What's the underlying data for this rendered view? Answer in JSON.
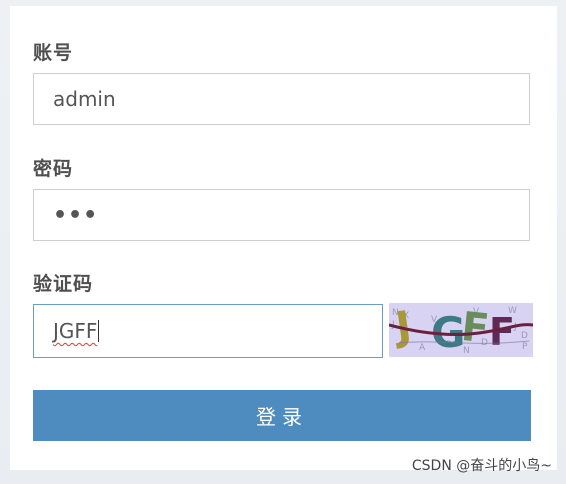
{
  "form": {
    "username_label": "账号",
    "username_value": "admin",
    "password_label": "密码",
    "password_value": "•••",
    "captcha_label": "验证码",
    "captcha_value": "JGFF",
    "captcha_image_text": "JGFF",
    "login_button": "登录"
  },
  "watermark": "CSDN @奋斗的小鸟~",
  "colors": {
    "button": "#4e8cc0",
    "captcha_bg": "#d8d3f2",
    "focus_border": "#6a9ccc"
  },
  "icons": {
    "captcha": "captcha-image"
  }
}
